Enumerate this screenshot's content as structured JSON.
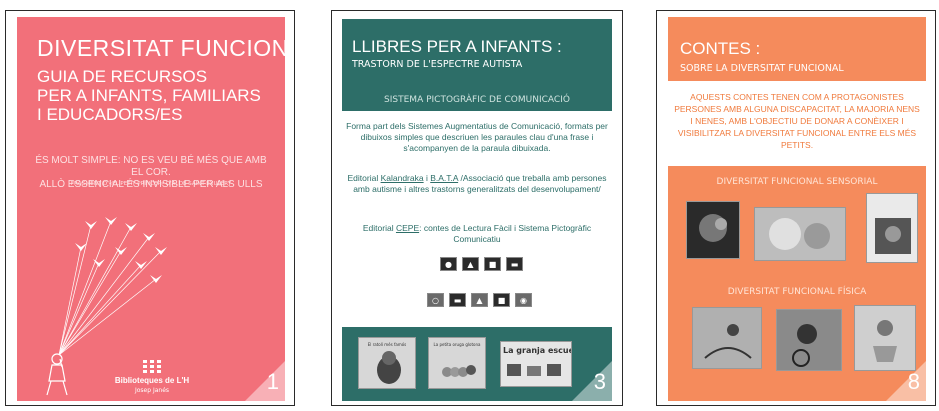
{
  "page1": {
    "title": "DIVERSITAT FUNCIONAL",
    "subtitle_lines": [
      "GUIA DE RECURSOS",
      "PER A INFANTS, FAMILIARS",
      "I EDUCADORS/ES"
    ],
    "quote_lines": [
      "ÉS MOLT SIMPLE: NO ES VEU BÉ MÉS QUE AMB EL COR.",
      "ALLÒ ESSENCIAL ÉS INVISIBLE PER ALS ULLS"
    ],
    "quote_author": "FRAGMENT D'«EL PETIT PRÍNCEP» D'A. DE SAINT-EXUPÉRY",
    "library": "Biblioteques de L'H",
    "library_name": "Josep Janés",
    "page_number": "1",
    "colors": {
      "background": "#f2707a"
    }
  },
  "page2": {
    "title": "LLIBRES PER A INFANTS :",
    "subtitle": "TRASTORN DE L'ESPECTRE AUTISTA",
    "system_label": "SISTEMA PICTOGRÀFIC DE COMUNICACIÓ",
    "description": "Forma part dels Sistemes Augmentatius de Comunicació, formats per dibuixos simples que descriuen les paraules clau d'una frase i s'acompanyen de la paraula dibuixada.",
    "editorial1_prefix": "Editorial ",
    "editorial1_name1": "Kalandraka",
    "editorial1_mid": " i ",
    "editorial1_name2": "B.A.T.A",
    "editorial1_rest": " /Associació que treballa amb persones amb autisme i altres trastorns generalitzats del desenvolupament/",
    "editorial2_prefix": "Editorial ",
    "editorial2_name": "CEPE",
    "editorial2_rest": ": contes de Lectura Fàcil i Sistema Pictogràfic Comunicatiu",
    "book_titles": [
      "El ratolí més famós",
      "La petita oruga glotona",
      "La granja escuela"
    ],
    "page_number": "3",
    "colors": {
      "header": "#2d6e68"
    }
  },
  "page3": {
    "title": "CONTES :",
    "subtitle": "SOBRE LA DIVERSITAT FUNCIONAL",
    "description": "AQUESTS CONTES TENEN COM A PROTAGONISTES PERSONES AMB ALGUNA DISCAPACITAT, LA MAJORIA NENS I NENES, AMB L'OBJECTIU DE DONAR A CONÈIXER I VISIBILITZAR LA DIVERSITAT FUNCIONAL ENTRE ELS MÉS PETITS.",
    "section1": "DIVERSITAT FUNCIONAL SENSORIAL",
    "section2": "DIVERSITAT FUNCIONAL FÍSICA",
    "page_number": "8",
    "colors": {
      "background": "#f58b5c"
    }
  }
}
